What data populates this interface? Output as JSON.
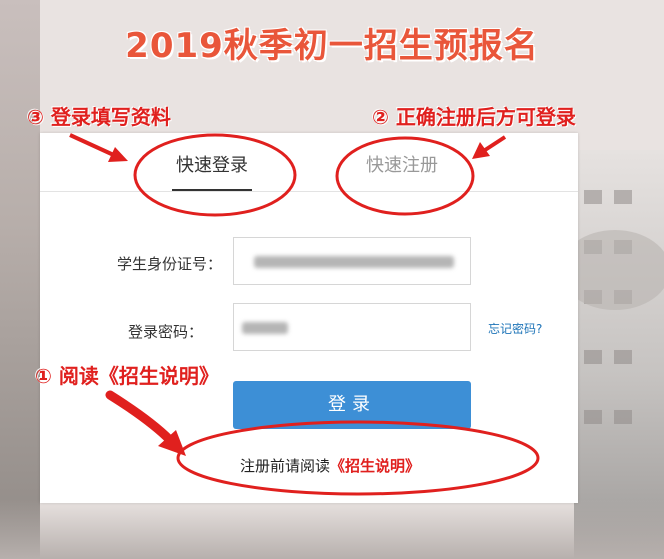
{
  "banner": {
    "title": "2019秋季初一招生预报名"
  },
  "annotations": {
    "step3": "③ 登录填写资料",
    "step2": "② 正确注册后方可登录",
    "step1": "① 阅读《招生说明》"
  },
  "tabs": {
    "login": "快速登录",
    "register": "快速注册"
  },
  "form": {
    "id_label": "学生身份证号：",
    "password_label": "登录密码：",
    "forgot_link": "忘记密码?",
    "login_button": "登录"
  },
  "notice": {
    "prefix": "注册前请阅读",
    "link": "《招生说明》"
  },
  "colors": {
    "title": "#e9563a",
    "annotation": "#e0201e",
    "button": "#3d8fd6",
    "link": "#1e74b8"
  }
}
